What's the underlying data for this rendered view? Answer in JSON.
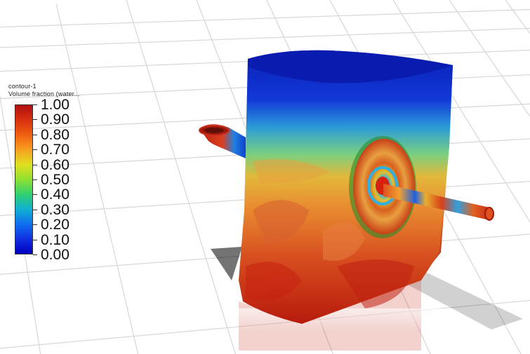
{
  "legend": {
    "name": "contour-1",
    "variable": "Volume fraction (water...",
    "ticks": [
      "1.00",
      "0.90",
      "0.80",
      "0.70",
      "0.60",
      "0.50",
      "0.40",
      "0.30",
      "0.20",
      "0.10",
      "0.00"
    ],
    "colormap": [
      "#b01010",
      "#d83010",
      "#f06010",
      "#f8a020",
      "#e0e020",
      "#90e030",
      "#30d070",
      "#10b0d0",
      "#1070f0",
      "#1030e0",
      "#0000c0"
    ]
  },
  "colors": {
    "background": "#ffffff",
    "grid": "#d8d8d8",
    "tank_top": "#0a20b8",
    "tank_bottom": "#c82010"
  }
}
